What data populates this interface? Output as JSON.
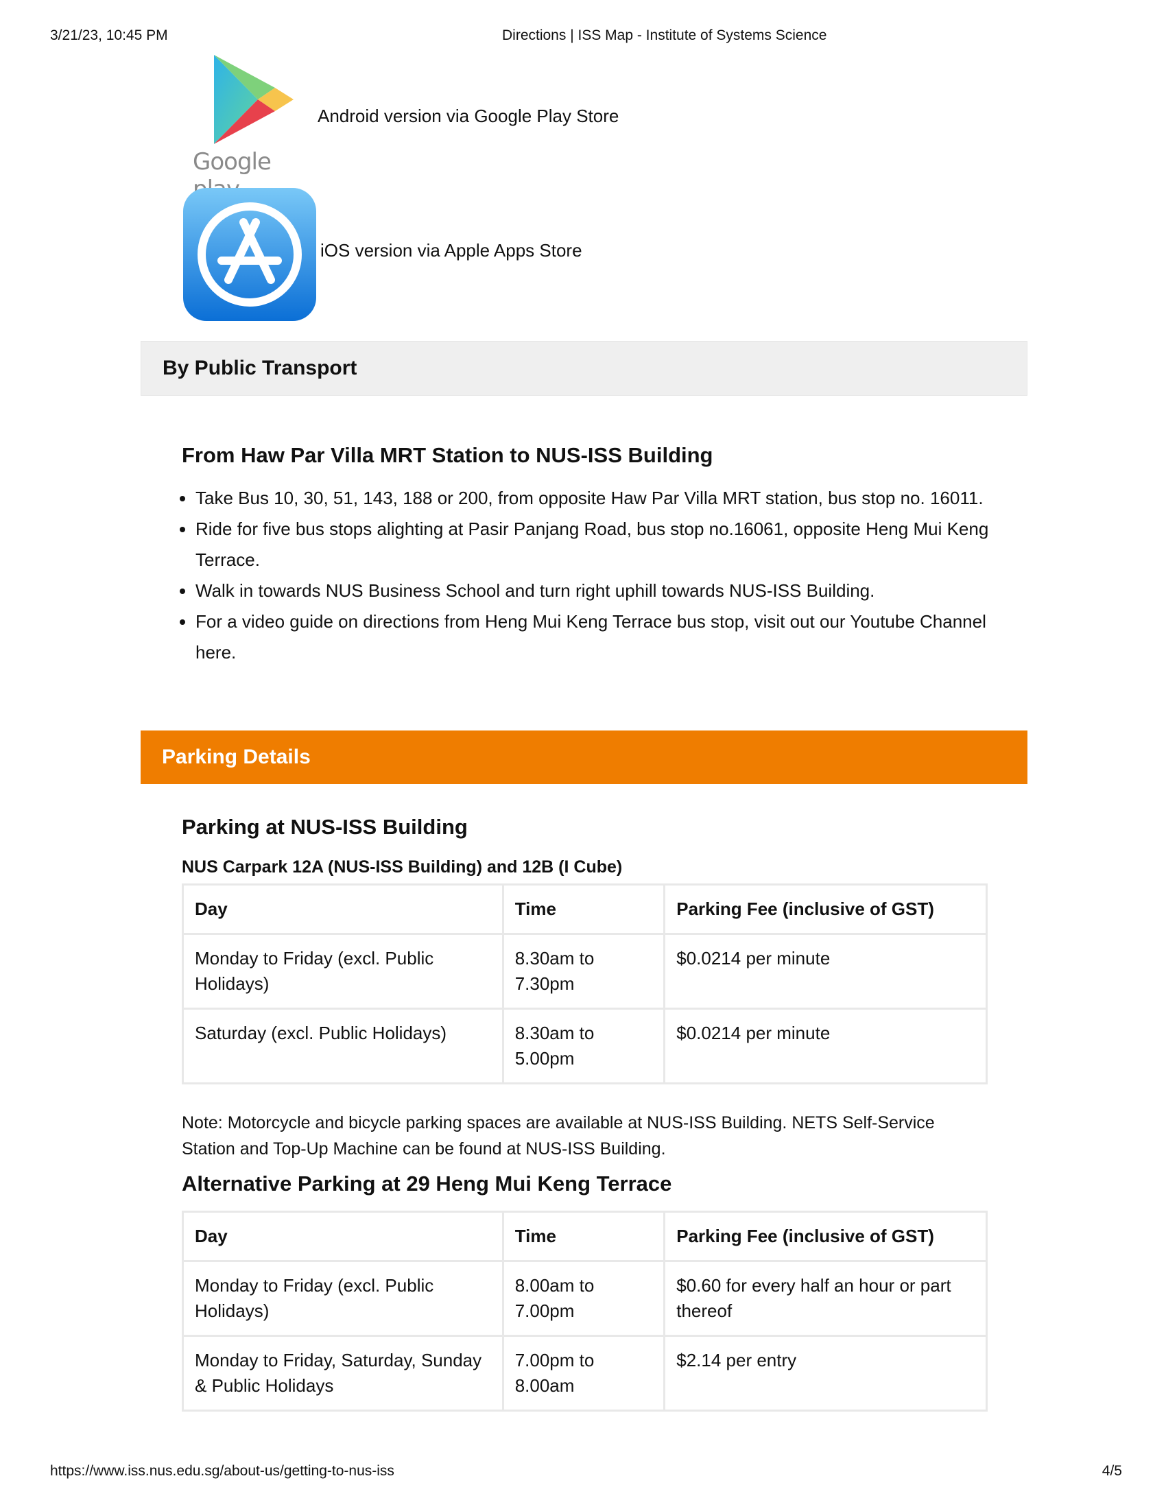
{
  "browser": {
    "timestamp": "3/21/23, 10:45 PM",
    "page_title": "Directions | ISS Map - Institute of Systems Science",
    "url": "https://www.iss.nus.edu.sg/about-us/getting-to-nus-iss",
    "page_number": "4/5"
  },
  "apps": {
    "google_play_logo_text": "Google play",
    "android_label": "Android version via Google Play Store",
    "ios_label": "iOS version via Apple Apps Store"
  },
  "public_transport": {
    "section_title": "By Public Transport",
    "heading": "From Haw Par Villa MRT Station to NUS-ISS Building",
    "steps": [
      "Take Bus 10, 30, 51, 143, 188 or 200, from opposite Haw Par Villa MRT station, bus stop no. 16011.",
      "Ride for five bus stops alighting at Pasir Panjang Road, bus stop no.16061, opposite Heng Mui Keng Terrace.",
      "Walk in towards NUS Business School and turn right uphill towards NUS-ISS Building.",
      "For a video guide on directions from Heng Mui Keng Terrace bus stop, visit out our Youtube Channel here."
    ]
  },
  "parking": {
    "section_title": "Parking Details",
    "heading": "Parking at NUS-ISS Building",
    "subheading": "NUS Carpark 12A (NUS-ISS Building) and 12B  (I Cube)",
    "table1": {
      "headers": [
        "Day",
        "Time",
        "Parking Fee (inclusive of GST)"
      ],
      "rows": [
        [
          "Monday to Friday (excl. Public Holidays)",
          "8.30am to 7.30pm",
          "$0.0214 per minute"
        ],
        [
          "Saturday (excl. Public Holidays)",
          "8.30am to 5.00pm",
          "$0.0214 per minute"
        ]
      ]
    },
    "note": "Note: Motorcycle and bicycle parking spaces are available at NUS-ISS Building. NETS Self-Service Station and Top-Up Machine can be found at NUS-ISS Building.",
    "alt_heading": "Alternative Parking at 29 Heng Mui Keng Terrace",
    "table2": {
      "headers": [
        "Day",
        "Time",
        "Parking Fee (inclusive of GST)"
      ],
      "rows": [
        [
          "Monday to Friday (excl. Public Holidays)",
          "8.00am to 7.00pm",
          "$0.60 for every half an hour or part thereof"
        ],
        [
          "Monday to Friday, Saturday, Sunday & Public Holidays",
          "7.00pm to 8.00am",
          "$2.14 per entry"
        ]
      ]
    }
  },
  "colors": {
    "accent_orange": "#ef7d00",
    "gray_bar": "#efefef"
  }
}
